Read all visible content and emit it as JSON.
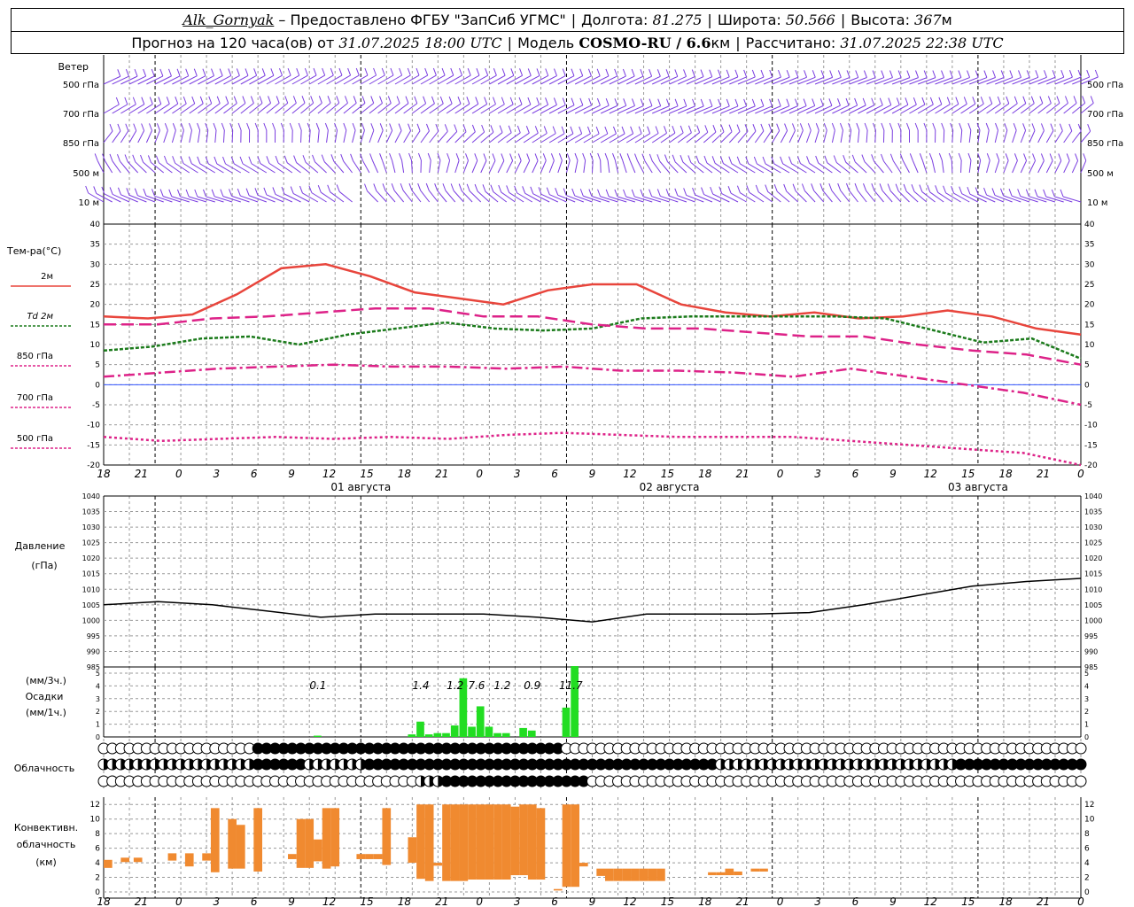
{
  "header": {
    "station": "Alk_Gornyak",
    "dash": " – ",
    "provider": "Предоставлено ФГБУ \"ЗапСиб УГМС\"",
    "lon_label": "Долгота: ",
    "lon_value": "81.275",
    "lat_label": "Широта: ",
    "lat_value": "50.566",
    "alt_label": "Высота: ",
    "alt_value": "367",
    "alt_unit": "м",
    "forecast_label": "Прогноз на 120 часа(ов) от ",
    "forecast_from": "31.07.2025 18:00 UTC",
    "model_label": "Модель ",
    "model_name": "COSMO-RU / 6.6",
    "model_unit": "км",
    "calc_label": "Рассчитано: ",
    "calc_time": "31.07.2025 22:38 UTC"
  },
  "panels": {
    "wind": {
      "title": "Ветер",
      "levels": [
        "500 гПа",
        "700 гПа",
        "850 гПа",
        "500 м",
        "10 м"
      ]
    },
    "temp": {
      "title": "Тем-ра(°С)",
      "legend": [
        {
          "label": "2м",
          "color": "#e8453c"
        },
        {
          "label": "Td 2м",
          "color": "#1a7a1a"
        },
        {
          "label": "850 гПа",
          "color": "#dd2288"
        },
        {
          "label": "700 гПа",
          "color": "#dd2288"
        },
        {
          "label": "500 гПа",
          "color": "#dd2288"
        }
      ]
    },
    "pressure": {
      "title1": "Давление",
      "title2": "(гПа)"
    },
    "precip": {
      "title1": "(мм/3ч.)",
      "title2": "Осадки",
      "title3": "(мм/1ч.)"
    },
    "cloud": {
      "title": "Облачность"
    },
    "convective": {
      "title1": "Конвективн.",
      "title2": "облачность",
      "title3": "(км)"
    }
  },
  "time_axis": {
    "hour_labels": [
      "18",
      "21",
      "0",
      "3",
      "6",
      "9",
      "12",
      "15",
      "18",
      "21",
      "0",
      "3",
      "6",
      "9",
      "12",
      "15",
      "18",
      "21",
      "0",
      "3",
      "6",
      "9",
      "12",
      "15",
      "18",
      "21",
      "0"
    ],
    "day_labels": [
      "01 августа",
      "02 августа",
      "03 августа"
    ]
  },
  "chart_data": [
    {
      "type": "line",
      "title": "Тем-ра(°С)",
      "x_hours": [
        0,
        6,
        12,
        18,
        24,
        30,
        36,
        42,
        48,
        54,
        60,
        66,
        72,
        78,
        84,
        90,
        96,
        102,
        108,
        114,
        120
      ],
      "ylim": [
        -20,
        40
      ],
      "yticks": [
        -20,
        -15,
        -10,
        -5,
        0,
        5,
        10,
        15,
        20,
        25,
        30,
        35,
        40
      ],
      "series": [
        {
          "name": "2м",
          "color": "#e8453c",
          "values": [
            17,
            16.5,
            17.5,
            22.5,
            29,
            30,
            27,
            23,
            21.5,
            20,
            23.5,
            25,
            25,
            20,
            18,
            17,
            18,
            16.5,
            17,
            18.5,
            17,
            14,
            12.5
          ]
        },
        {
          "name": "Td 2м",
          "color": "#1a7a1a",
          "values": [
            8.5,
            9.5,
            11.5,
            12,
            10,
            12.5,
            14,
            15.5,
            14,
            13.5,
            14,
            16.5,
            17,
            17,
            17,
            17,
            16.5,
            13.5,
            10.5,
            11.5,
            6.5
          ]
        },
        {
          "name": "850 гПа",
          "color": "#dd2288",
          "values": [
            15,
            15,
            16.5,
            17,
            18,
            19,
            19,
            17,
            17,
            15,
            14,
            14,
            13,
            12,
            12,
            10,
            8.5,
            7.5,
            5
          ]
        },
        {
          "name": "700 гПа",
          "color": "#dd2288",
          "values": [
            2,
            3,
            4,
            4.5,
            5,
            4.5,
            4.5,
            4,
            4.5,
            3.5,
            3.5,
            3,
            2,
            4,
            2,
            0,
            -2,
            -5
          ]
        },
        {
          "name": "500 гПа",
          "color": "#dd2288",
          "values": [
            -13,
            -14,
            -13.5,
            -13,
            -13.5,
            -13,
            -13.5,
            -12.5,
            -12,
            -12.5,
            -13,
            -13,
            -13,
            -14,
            -15,
            -16,
            -17,
            -20
          ]
        }
      ]
    },
    {
      "type": "line",
      "title": "Давление (гПа)",
      "ylim": [
        985,
        1040
      ],
      "yticks": [
        985,
        990,
        995,
        1000,
        1005,
        1010,
        1015,
        1020,
        1025,
        1030,
        1035,
        1040
      ],
      "series": [
        {
          "name": "Давление",
          "color": "#000000",
          "values": [
            1005,
            1006,
            1005,
            1003,
            1001,
            1002,
            1002,
            1002,
            1001,
            999.5,
            1002,
            1002,
            1002,
            1002.5,
            1005,
            1008,
            1011,
            1012.5,
            1013.5
          ]
        }
      ]
    },
    {
      "type": "bar",
      "title": "Осадки",
      "ylim": [
        0,
        5
      ],
      "yticks": [
        0,
        1,
        2,
        3,
        4,
        5
      ],
      "labels_3h": [
        "0.1",
        "1.4",
        "1.2",
        "7.6",
        "1.2",
        "0.9",
        "11.7"
      ],
      "bars": [
        {
          "h": 25,
          "v": 0.1
        },
        {
          "h": 36,
          "v": 0.2
        },
        {
          "h": 37,
          "v": 1.2
        },
        {
          "h": 38,
          "v": 0.2
        },
        {
          "h": 39,
          "v": 0.3
        },
        {
          "h": 40,
          "v": 0.3
        },
        {
          "h": 41,
          "v": 0.9
        },
        {
          "h": 42,
          "v": 4.6
        },
        {
          "h": 43,
          "v": 0.8
        },
        {
          "h": 44,
          "v": 2.4
        },
        {
          "h": 45,
          "v": 0.8
        },
        {
          "h": 46,
          "v": 0.3
        },
        {
          "h": 47,
          "v": 0.3
        },
        {
          "h": 49,
          "v": 0.7
        },
        {
          "h": 50,
          "v": 0.5
        },
        {
          "h": 54,
          "v": 2.3
        },
        {
          "h": 55,
          "v": 5.8
        }
      ]
    },
    {
      "type": "bar",
      "title": "Конвективн. облачность (км)",
      "ylim": [
        0,
        13
      ],
      "yticks": [
        0,
        2,
        4,
        6,
        8,
        10,
        12
      ],
      "bars": [
        {
          "h": 0.5,
          "lo": 3.3,
          "hi": 4.4
        },
        {
          "h": 2.5,
          "lo": 4.1,
          "hi": 4.7
        },
        {
          "h": 4,
          "lo": 4.1,
          "hi": 4.7
        },
        {
          "h": 8,
          "lo": 4.3,
          "hi": 5.3
        },
        {
          "h": 10,
          "lo": 3.5,
          "hi": 5.3
        },
        {
          "h": 12,
          "lo": 4.3,
          "hi": 5.3
        },
        {
          "h": 13,
          "lo": 2.7,
          "hi": 11.5
        },
        {
          "h": 15,
          "lo": 3.2,
          "hi": 10
        },
        {
          "h": 16,
          "lo": 3.2,
          "hi": 9.2
        },
        {
          "h": 18,
          "lo": 2.8,
          "hi": 11.5
        },
        {
          "h": 22,
          "lo": 4.5,
          "hi": 5.2
        },
        {
          "h": 23,
          "lo": 3.3,
          "hi": 10
        },
        {
          "h": 24,
          "lo": 3.3,
          "hi": 10
        },
        {
          "h": 25,
          "lo": 4.2,
          "hi": 7.2
        },
        {
          "h": 26,
          "lo": 3.2,
          "hi": 11.5
        },
        {
          "h": 27,
          "lo": 3.5,
          "hi": 11.5
        },
        {
          "h": 30,
          "lo": 4.5,
          "hi": 5.2
        },
        {
          "h": 31,
          "lo": 4.5,
          "hi": 5.2
        },
        {
          "h": 32,
          "lo": 4.5,
          "hi": 5.2
        },
        {
          "h": 33,
          "lo": 3.7,
          "hi": 11.5
        },
        {
          "h": 36,
          "lo": 4,
          "hi": 7.5
        },
        {
          "h": 37,
          "lo": 1.8,
          "hi": 12
        },
        {
          "h": 38,
          "lo": 1.5,
          "hi": 12
        },
        {
          "h": 39,
          "lo": 3.6,
          "hi": 4
        },
        {
          "h": 40,
          "lo": 1.5,
          "hi": 12
        },
        {
          "h": 41,
          "lo": 1.5,
          "hi": 12
        },
        {
          "h": 42,
          "lo": 1.5,
          "hi": 12
        },
        {
          "h": 43,
          "lo": 1.7,
          "hi": 12
        },
        {
          "h": 44,
          "lo": 1.7,
          "hi": 12
        },
        {
          "h": 45,
          "lo": 1.7,
          "hi": 12
        },
        {
          "h": 46,
          "lo": 1.7,
          "hi": 12
        },
        {
          "h": 47,
          "lo": 1.7,
          "hi": 12
        },
        {
          "h": 48,
          "lo": 2.3,
          "hi": 11.7
        },
        {
          "h": 49,
          "lo": 2.3,
          "hi": 12
        },
        {
          "h": 50,
          "lo": 1.7,
          "hi": 12
        },
        {
          "h": 51,
          "lo": 1.7,
          "hi": 11.5
        },
        {
          "h": 53,
          "lo": 0.2,
          "hi": 0.4
        },
        {
          "h": 54,
          "lo": 0.7,
          "hi": 12
        },
        {
          "h": 55,
          "lo": 0.7,
          "hi": 12
        },
        {
          "h": 56,
          "lo": 3.5,
          "hi": 4
        },
        {
          "h": 58,
          "lo": 2.2,
          "hi": 3.2
        },
        {
          "h": 59,
          "lo": 1.5,
          "hi": 3.2
        },
        {
          "h": 60,
          "lo": 1.5,
          "hi": 3.2
        },
        {
          "h": 61,
          "lo": 1.5,
          "hi": 3.2
        },
        {
          "h": 62,
          "lo": 1.5,
          "hi": 3.2
        },
        {
          "h": 63,
          "lo": 1.5,
          "hi": 3.2
        },
        {
          "h": 64,
          "lo": 1.5,
          "hi": 3.2
        },
        {
          "h": 65,
          "lo": 1.5,
          "hi": 3.2
        },
        {
          "h": 71,
          "lo": 2.3,
          "hi": 2.7
        },
        {
          "h": 72,
          "lo": 2.3,
          "hi": 2.7
        },
        {
          "h": 73,
          "lo": 2.3,
          "hi": 3.2
        },
        {
          "h": 74,
          "lo": 2.3,
          "hi": 2.8
        },
        {
          "h": 76,
          "lo": 2.8,
          "hi": 3.2
        },
        {
          "h": 77,
          "lo": 2.8,
          "hi": 3.2
        }
      ]
    }
  ]
}
